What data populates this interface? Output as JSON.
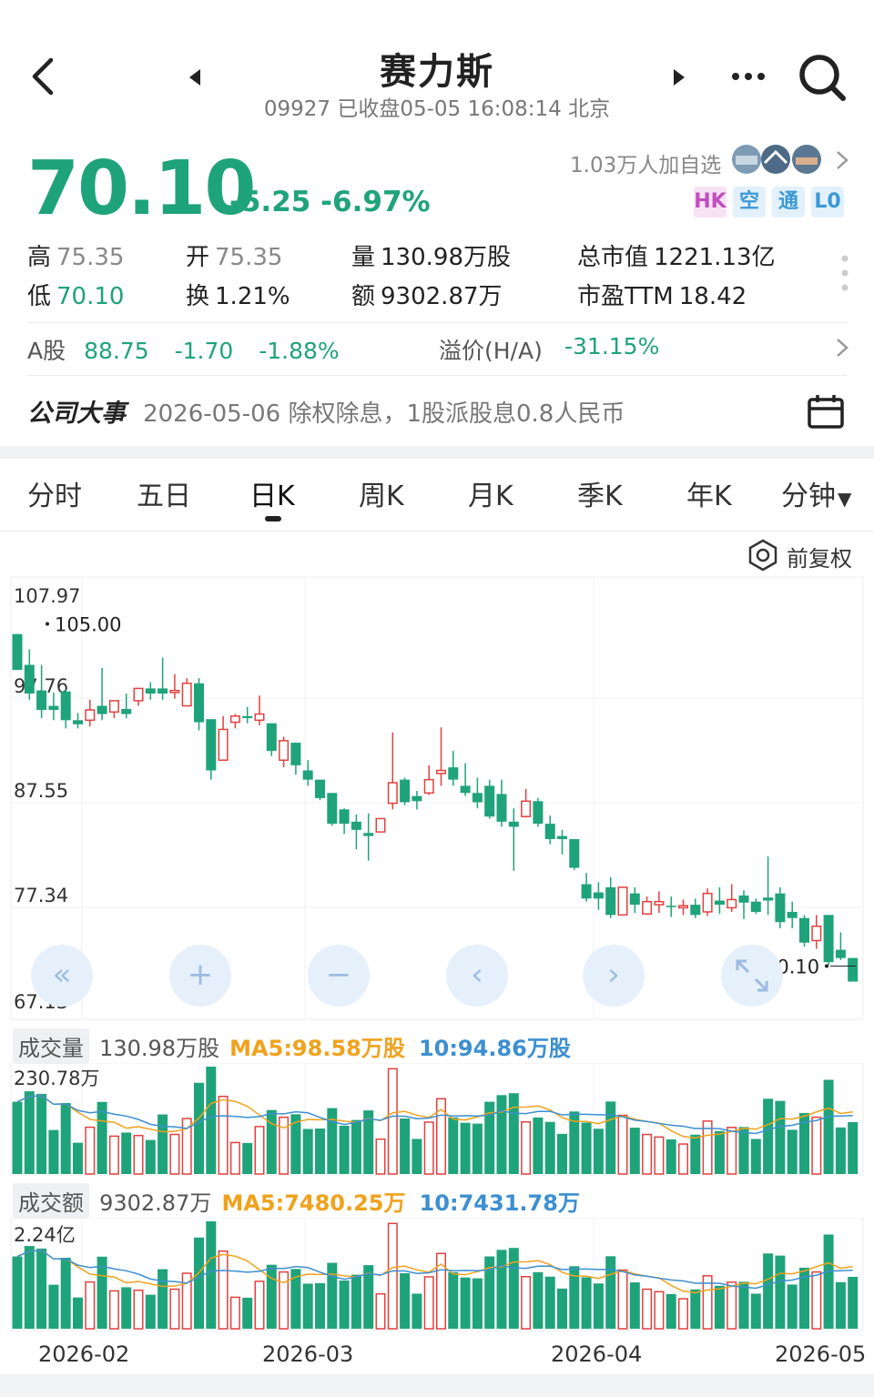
{
  "header": {
    "title": "赛力斯",
    "subtitle": "09927 已收盘05-05 16:08:14 北京"
  },
  "quote": {
    "price": "70.10",
    "change": "-5.25",
    "change_pct": "-6.97%",
    "followers": "1.03万人加自选",
    "badges": [
      "HK",
      "空",
      "通",
      "L0"
    ],
    "high_label": "高",
    "high": "75.35",
    "open_label": "开",
    "open": "75.35",
    "volume_label": "量",
    "volume": "130.98万股",
    "mcap_label": "总市值",
    "mcap": "1221.13亿",
    "low_label": "低",
    "low": "70.10",
    "turnover_label": "换",
    "turnover": "1.21%",
    "amount_label": "额",
    "amount": "9302.87万",
    "pe_label": "市盈TTM",
    "pe": "18.42"
  },
  "a_share": {
    "label": "A股",
    "price": "88.75",
    "change": "-1.70",
    "change_pct": "-1.88%",
    "premium_label": "溢价(H/A)",
    "premium": "-31.15%"
  },
  "event": {
    "label": "公司大事",
    "text": "2026-05-06 除权除息，1股派股息0.8人民币"
  },
  "tabs": [
    "分时",
    "五日",
    "日K",
    "周K",
    "月K",
    "季K",
    "年K",
    "分钟"
  ],
  "active_tab": "日K",
  "adjust_label": "前复权",
  "colors": {
    "down": "#1fa37a",
    "up": "#e0413f",
    "ma5": "#f0a21e",
    "ma10": "#3d8fd0"
  },
  "chart_data": {
    "type": "candlestick",
    "y_ticks": [
      "107.97",
      "97.76",
      "87.55",
      "77.34",
      "67.13"
    ],
    "ylim": [
      67.13,
      107.97
    ],
    "x_ticks": [
      "2026-02",
      "2026-03",
      "2026-04",
      "2026-05"
    ],
    "max_label": "105.00",
    "last_label": "70.10",
    "candles": [
      {
        "o": 104.0,
        "c": 100.5,
        "h": 104.0,
        "l": 100.5
      },
      {
        "o": 101.0,
        "c": 98.2,
        "h": 102.5,
        "l": 97.6
      },
      {
        "o": 98.5,
        "c": 96.6,
        "h": 101.0,
        "l": 95.8
      },
      {
        "o": 97.0,
        "c": 96.6,
        "h": 98.3,
        "l": 95.6
      },
      {
        "o": 98.4,
        "c": 95.6,
        "h": 98.6,
        "l": 94.8
      },
      {
        "o": 95.6,
        "c": 95.2,
        "h": 96.3,
        "l": 94.8
      },
      {
        "o": 95.6,
        "c": 96.6,
        "h": 97.6,
        "l": 95.0
      },
      {
        "o": 97.0,
        "c": 96.2,
        "h": 100.7,
        "l": 95.6
      },
      {
        "o": 96.4,
        "c": 97.5,
        "h": 97.5,
        "l": 95.8
      },
      {
        "o": 96.7,
        "c": 96.2,
        "h": 98.2,
        "l": 95.8
      },
      {
        "o": 97.5,
        "c": 98.7,
        "h": 98.7,
        "l": 97.0
      },
      {
        "o": 98.7,
        "c": 98.2,
        "h": 99.3,
        "l": 97.6
      },
      {
        "o": 98.7,
        "c": 98.2,
        "h": 101.7,
        "l": 97.6
      },
      {
        "o": 98.3,
        "c": 98.5,
        "h": 100.1,
        "l": 97.7
      },
      {
        "o": 97.0,
        "c": 99.2,
        "h": 99.7,
        "l": 97.0
      },
      {
        "o": 99.2,
        "c": 95.4,
        "h": 99.7,
        "l": 94.6
      },
      {
        "o": 95.7,
        "c": 90.7,
        "h": 95.7,
        "l": 89.8
      },
      {
        "o": 91.7,
        "c": 94.7,
        "h": 96.0,
        "l": 91.7
      },
      {
        "o": 95.4,
        "c": 96.0,
        "h": 96.2,
        "l": 94.8
      },
      {
        "o": 96.0,
        "c": 95.8,
        "h": 96.9,
        "l": 95.3
      },
      {
        "o": 95.6,
        "c": 96.2,
        "h": 98.0,
        "l": 95.1
      },
      {
        "o": 95.3,
        "c": 92.6,
        "h": 95.3,
        "l": 92.1
      },
      {
        "o": 91.7,
        "c": 93.6,
        "h": 94.0,
        "l": 91.0
      },
      {
        "o": 93.4,
        "c": 91.2,
        "h": 93.4,
        "l": 90.3
      },
      {
        "o": 90.7,
        "c": 89.8,
        "h": 91.7,
        "l": 89.2
      },
      {
        "o": 89.8,
        "c": 88.0,
        "h": 89.8,
        "l": 87.8
      },
      {
        "o": 88.5,
        "c": 85.5,
        "h": 88.5,
        "l": 85.3
      },
      {
        "o": 86.9,
        "c": 85.5,
        "h": 87.0,
        "l": 84.5
      },
      {
        "o": 85.7,
        "c": 84.9,
        "h": 86.4,
        "l": 83.0
      },
      {
        "o": 84.6,
        "c": 84.3,
        "h": 86.5,
        "l": 81.9
      },
      {
        "o": 84.7,
        "c": 86.0,
        "h": 86.0,
        "l": 84.7
      },
      {
        "o": 87.5,
        "c": 89.5,
        "h": 94.4,
        "l": 86.9
      },
      {
        "o": 89.8,
        "c": 87.6,
        "h": 90.0,
        "l": 87.3
      },
      {
        "o": 88.2,
        "c": 87.7,
        "h": 88.7,
        "l": 86.9
      },
      {
        "o": 88.5,
        "c": 89.8,
        "h": 91.2,
        "l": 88.3
      },
      {
        "o": 90.4,
        "c": 90.7,
        "h": 94.9,
        "l": 89.2
      },
      {
        "o": 91.0,
        "c": 89.8,
        "h": 92.6,
        "l": 89.2
      },
      {
        "o": 89.2,
        "c": 88.5,
        "h": 91.4,
        "l": 88.2
      },
      {
        "o": 88.5,
        "c": 87.6,
        "h": 90.0,
        "l": 87.0
      },
      {
        "o": 89.2,
        "c": 86.2,
        "h": 89.8,
        "l": 86.0
      },
      {
        "o": 88.4,
        "c": 85.7,
        "h": 89.8,
        "l": 85.2
      },
      {
        "o": 85.7,
        "c": 85.2,
        "h": 87.0,
        "l": 80.9
      },
      {
        "o": 86.2,
        "c": 87.7,
        "h": 88.9,
        "l": 86.1
      },
      {
        "o": 87.7,
        "c": 85.5,
        "h": 88.0,
        "l": 85.2
      },
      {
        "o": 85.5,
        "c": 84.0,
        "h": 86.3,
        "l": 83.5
      },
      {
        "o": 84.3,
        "c": 84.0,
        "h": 84.9,
        "l": 82.5
      },
      {
        "o": 84.0,
        "c": 81.2,
        "h": 84.0,
        "l": 81.0
      },
      {
        "o": 79.6,
        "c": 78.2,
        "h": 80.7,
        "l": 77.9
      },
      {
        "o": 78.8,
        "c": 78.2,
        "h": 79.8,
        "l": 77.1
      },
      {
        "o": 79.3,
        "c": 76.6,
        "h": 80.3,
        "l": 76.3
      },
      {
        "o": 76.6,
        "c": 79.3,
        "h": 79.3,
        "l": 76.6
      },
      {
        "o": 78.7,
        "c": 77.6,
        "h": 79.3,
        "l": 76.8
      },
      {
        "o": 76.7,
        "c": 77.9,
        "h": 78.4,
        "l": 76.6
      },
      {
        "o": 77.6,
        "c": 77.9,
        "h": 78.9,
        "l": 76.8
      },
      {
        "o": 77.5,
        "c": 77.4,
        "h": 78.4,
        "l": 76.4
      },
      {
        "o": 77.3,
        "c": 77.5,
        "h": 78.1,
        "l": 76.6
      },
      {
        "o": 77.6,
        "c": 76.6,
        "h": 78.2,
        "l": 76.3
      },
      {
        "o": 76.9,
        "c": 78.7,
        "h": 79.2,
        "l": 76.5
      },
      {
        "o": 78.0,
        "c": 77.6,
        "h": 79.3,
        "l": 76.7
      },
      {
        "o": 77.3,
        "c": 78.1,
        "h": 79.6,
        "l": 76.9
      },
      {
        "o": 78.5,
        "c": 77.8,
        "h": 79.0,
        "l": 76.2
      },
      {
        "o": 77.9,
        "c": 76.9,
        "h": 78.2,
        "l": 76.7
      },
      {
        "o": 78.3,
        "c": 78.0,
        "h": 82.3,
        "l": 76.6
      },
      {
        "o": 78.7,
        "c": 75.9,
        "h": 79.3,
        "l": 75.3
      },
      {
        "o": 76.9,
        "c": 76.3,
        "h": 77.9,
        "l": 75.3
      },
      {
        "o": 76.3,
        "c": 73.9,
        "h": 76.6,
        "l": 73.5
      },
      {
        "o": 74.1,
        "c": 75.5,
        "h": 76.6,
        "l": 73.3
      },
      {
        "o": 76.6,
        "c": 72.0,
        "h": 76.6,
        "l": 71.7
      },
      {
        "o": 73.2,
        "c": 72.4,
        "h": 74.9,
        "l": 72.2
      },
      {
        "o": 72.4,
        "c": 70.1,
        "h": 72.4,
        "l": 70.1
      }
    ],
    "volume": {
      "label": "成交量",
      "value": "130.98万股",
      "ma5": "MA5:98.58万股",
      "ma10": "10:94.86万股",
      "max_label": "230.78万",
      "max": 230.78
    },
    "amount": {
      "label": "成交额",
      "value": "9302.87万",
      "ma5": "MA5:7480.25万",
      "ma10": "10:7431.78万",
      "max_label": "2.24亿",
      "max": 2.24
    }
  }
}
